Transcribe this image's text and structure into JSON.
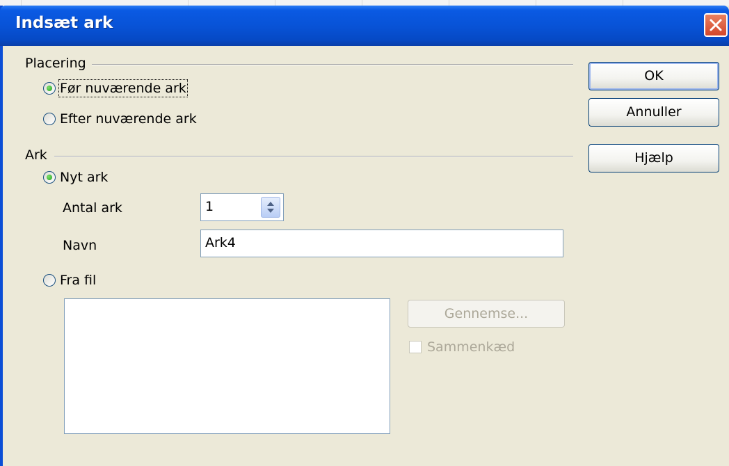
{
  "window": {
    "title": "Indsæt ark"
  },
  "placement": {
    "label": "Placering",
    "options": [
      {
        "label": "Før nuværende ark",
        "selected": true
      },
      {
        "label": "Efter nuværende ark",
        "selected": false
      }
    ]
  },
  "sheet": {
    "label": "Ark",
    "new_sheet": {
      "label": "Nyt ark",
      "selected": true
    },
    "count": {
      "label": "Antal ark",
      "value": "1"
    },
    "name": {
      "label": "Navn",
      "value": "Ark4"
    },
    "from_file": {
      "label": "Fra fil",
      "selected": false
    },
    "browse_label": "Gennemse...",
    "link_label": "Sammenkæd"
  },
  "buttons": {
    "ok": "OK",
    "cancel": "Annuller",
    "help": "Hjælp"
  },
  "colors": {
    "titlebar": "#0853d7",
    "dialog_bg": "#ece9d8",
    "close": "#d3462b",
    "radio_dot": "#21a121"
  },
  "icons": [
    "close-icon",
    "spin-up-icon",
    "spin-down-icon"
  ]
}
